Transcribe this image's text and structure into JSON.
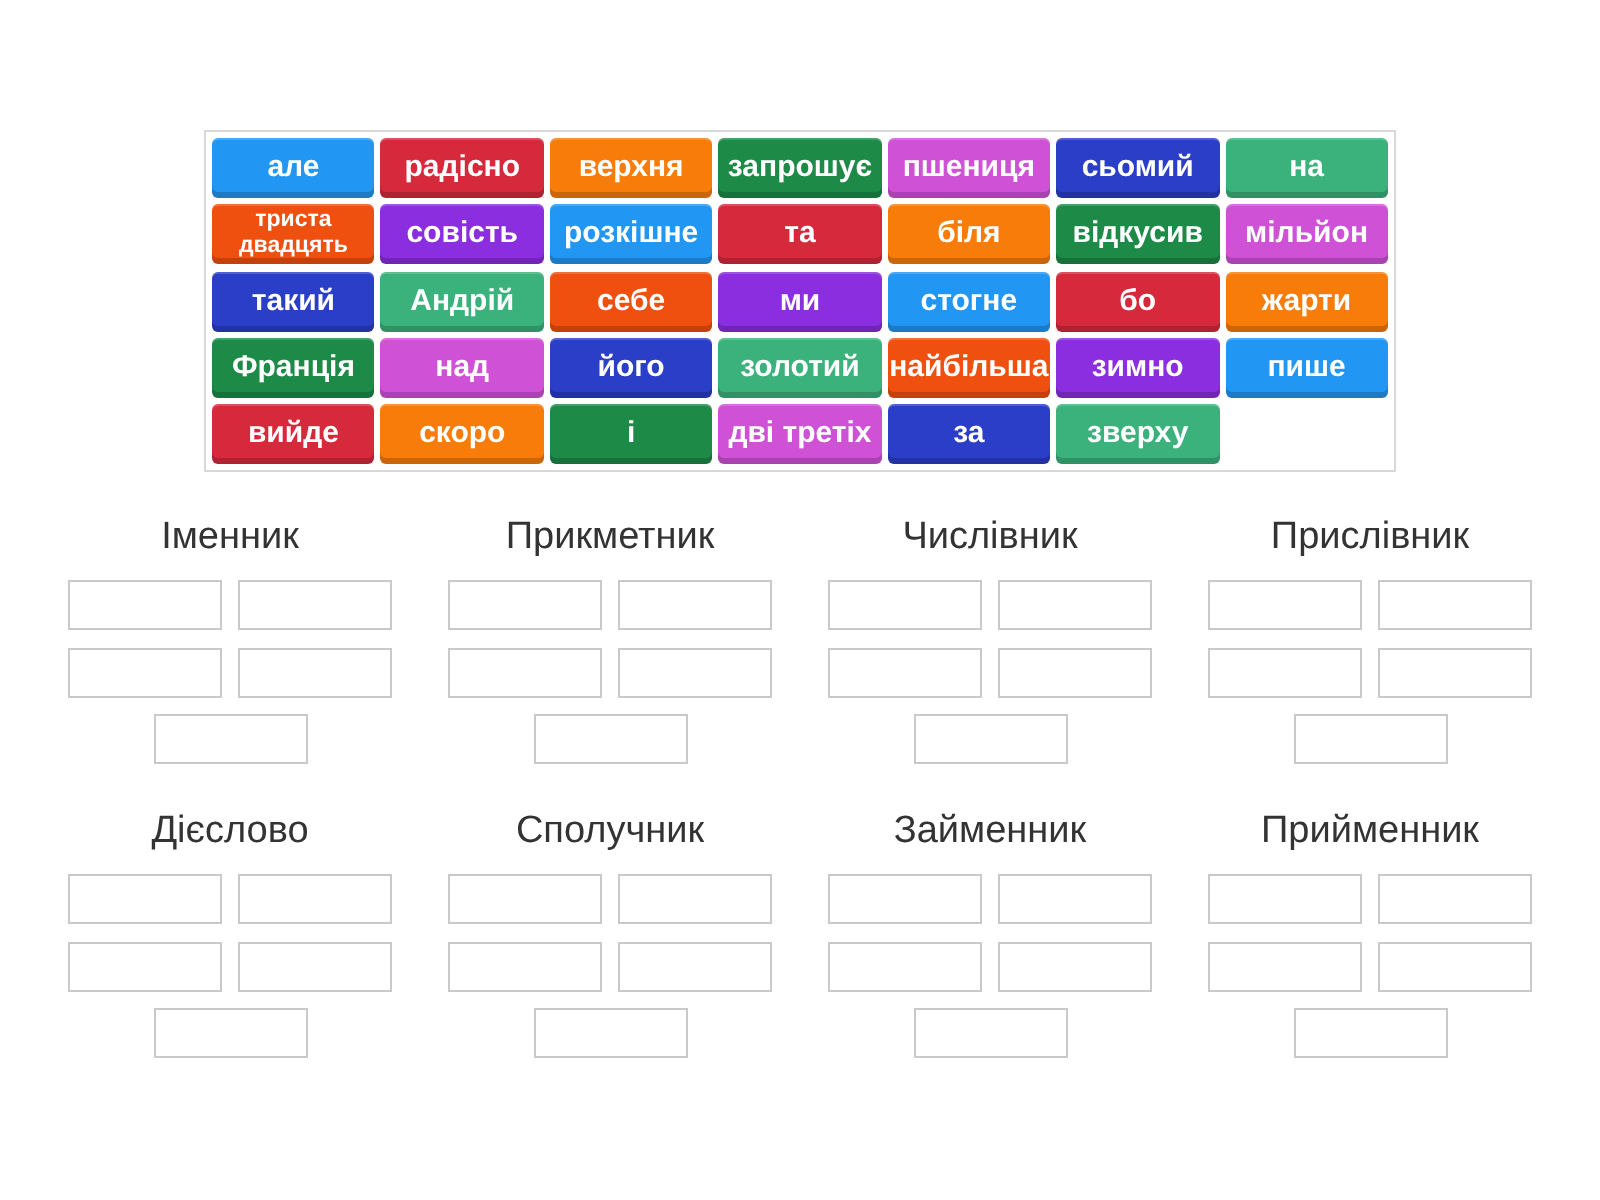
{
  "tiles": [
    {
      "text": "але",
      "color": "#2196f3"
    },
    {
      "text": "радісно",
      "color": "#d62a3c"
    },
    {
      "text": "верхня",
      "color": "#f77c0a"
    },
    {
      "text": "запрошує",
      "color": "#1e8a48"
    },
    {
      "text": "пшениця",
      "color": "#cf52d6"
    },
    {
      "text": "сьомий",
      "color": "#2a3ec8"
    },
    {
      "text": "на",
      "color": "#3bb17c"
    },
    {
      "text": "триста двадцять",
      "color": "#f0500f"
    },
    {
      "text": "совість",
      "color": "#8a2ee0"
    },
    {
      "text": "розкішне",
      "color": "#2196f3"
    },
    {
      "text": "та",
      "color": "#d62a3c"
    },
    {
      "text": "біля",
      "color": "#f77c0a"
    },
    {
      "text": "відкусив",
      "color": "#1e8a48"
    },
    {
      "text": "мільйон",
      "color": "#cf52d6"
    },
    {
      "text": "такий",
      "color": "#2a3ec8"
    },
    {
      "text": "Андрій",
      "color": "#3bb17c"
    },
    {
      "text": "себе",
      "color": "#f0500f"
    },
    {
      "text": "ми",
      "color": "#8a2ee0"
    },
    {
      "text": "стогне",
      "color": "#2196f3"
    },
    {
      "text": "бо",
      "color": "#d62a3c"
    },
    {
      "text": "жарти",
      "color": "#f77c0a"
    },
    {
      "text": "Франція",
      "color": "#1e8a48"
    },
    {
      "text": "над",
      "color": "#cf52d6"
    },
    {
      "text": "його",
      "color": "#2a3ec8"
    },
    {
      "text": "золотий",
      "color": "#3bb17c"
    },
    {
      "text": "найбільша",
      "color": "#f0500f"
    },
    {
      "text": "зимно",
      "color": "#8a2ee0"
    },
    {
      "text": "пише",
      "color": "#2196f3"
    },
    {
      "text": "вийде",
      "color": "#d62a3c"
    },
    {
      "text": "скоро",
      "color": "#f77c0a"
    },
    {
      "text": "і",
      "color": "#1e8a48"
    },
    {
      "text": "дві третіх",
      "color": "#cf52d6"
    },
    {
      "text": "за",
      "color": "#2a3ec8"
    },
    {
      "text": "зверху",
      "color": "#3bb17c"
    }
  ],
  "groups": [
    {
      "title": "Іменник"
    },
    {
      "title": "Прикметник"
    },
    {
      "title": "Числівник"
    },
    {
      "title": "Прислівник"
    },
    {
      "title": "Дієслово"
    },
    {
      "title": "Сполучник"
    },
    {
      "title": "Займенник"
    },
    {
      "title": "Прийменник"
    }
  ]
}
